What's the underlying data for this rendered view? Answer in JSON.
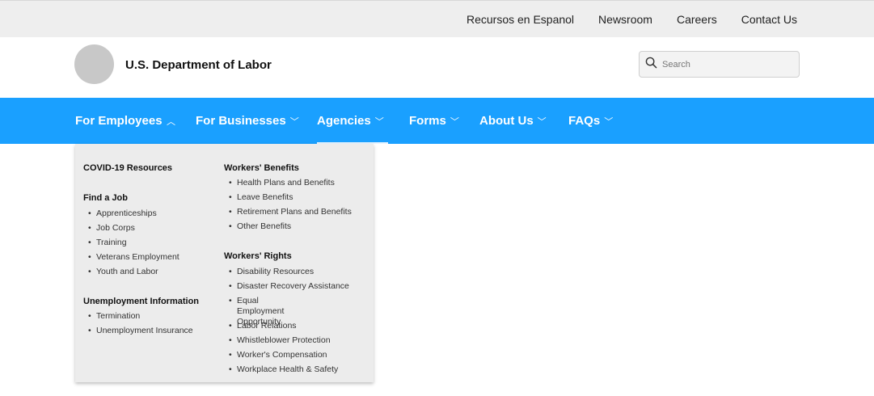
{
  "utility_nav": {
    "links": [
      "Recursos en Espanol",
      "Newsroom",
      "Careers",
      "Contact Us"
    ]
  },
  "header": {
    "site_title": "U.S. Department of Labor",
    "search_placeholder": "Search"
  },
  "main_nav": {
    "items": [
      {
        "label": "For Employees",
        "expanded": true
      },
      {
        "label": "For Businesses",
        "expanded": false
      },
      {
        "label": "Agencies",
        "expanded": false
      },
      {
        "label": "Forms",
        "expanded": false
      },
      {
        "label": "About Us",
        "expanded": false
      },
      {
        "label": "FAQs",
        "expanded": false
      }
    ],
    "background": "#1aa0ff"
  },
  "dropdown": {
    "left_column": [
      {
        "title": "COVID-19 Resources",
        "items": []
      },
      {
        "title": "Find a Job",
        "items": [
          "Apprenticeships",
          "Job Corps",
          "Training",
          "Veterans Employment",
          "Youth and Labor"
        ]
      },
      {
        "title": "Unemployment Information",
        "items": [
          "Termination",
          "Unemployment Insurance"
        ]
      }
    ],
    "right_column": [
      {
        "title": "Workers' Benefits",
        "items": [
          "Health Plans and Benefits",
          "Leave Benefits",
          "Retirement Plans and Benefits",
          "Other Benefits"
        ]
      },
      {
        "title": "Workers' Rights",
        "items": [
          "Disability Resources",
          "Disaster Recovery Assistance",
          "Equal Employment\nOpportunity",
          "Labor Relations",
          "Whistleblower Protection",
          "Worker's Compensation",
          "Workplace Health & Safety"
        ]
      }
    ]
  }
}
